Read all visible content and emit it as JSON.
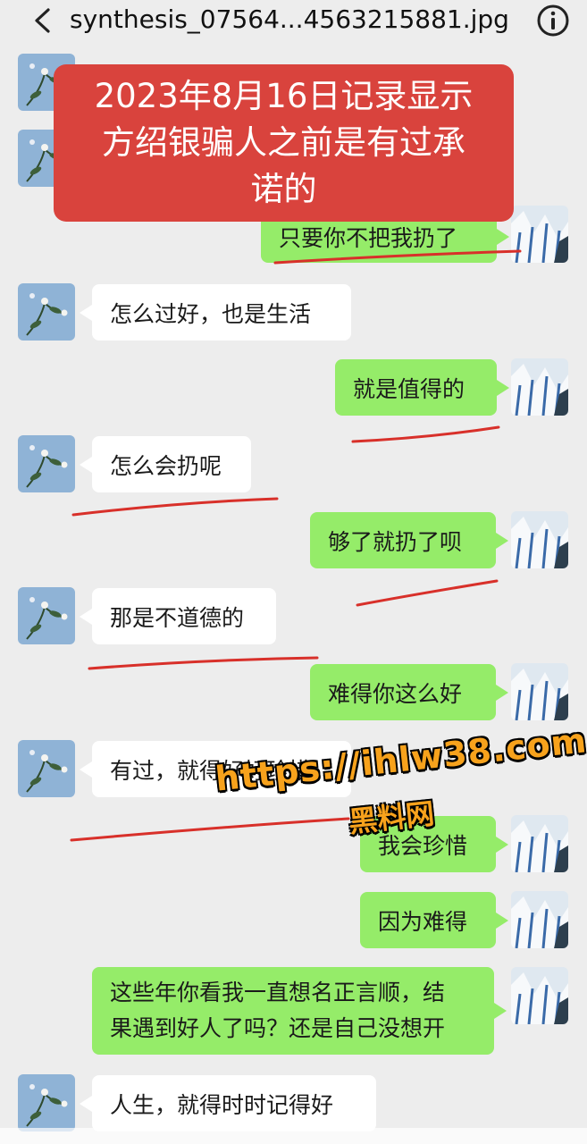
{
  "window": {
    "title": "synthesis_07564...4563215881.jpg",
    "back_icon": "chevron-left-icon",
    "info_icon": "info-icon"
  },
  "banner": {
    "lines": [
      "2023年8月16日记录显示",
      "方绍银骗人之前是有过承",
      "诺的"
    ]
  },
  "messages": [
    {
      "side": "out",
      "text": "只要你不把我扔了"
    },
    {
      "side": "in",
      "text": "怎么过好，也是生活"
    },
    {
      "side": "out",
      "text": "就是值得的"
    },
    {
      "side": "in",
      "text": "怎么会扔呢"
    },
    {
      "side": "out",
      "text": "够了就扔了呗"
    },
    {
      "side": "in",
      "text": "那是不道德的"
    },
    {
      "side": "out",
      "text": "难得你这么好"
    },
    {
      "side": "in",
      "text": "有过，就得好好珍惜"
    },
    {
      "side": "out",
      "text": "我会珍惜"
    },
    {
      "side": "out",
      "text": "因为难得"
    },
    {
      "side": "out",
      "lines": [
        "这些年你看我一直想名正言顺，结",
        "果遇到好人了吗？还是自己没想开"
      ]
    },
    {
      "side": "in",
      "text": "人生，就得时时记得好"
    }
  ],
  "watermark": {
    "url": "https://ihlw38.com",
    "site": "黑料网"
  },
  "colors": {
    "background": "#ededed",
    "incoming_bubble": "#ffffff",
    "outgoing_bubble": "#95ec69",
    "banner": "#d9433d",
    "underline": "#d8302a",
    "watermark": "#f7a21c"
  }
}
